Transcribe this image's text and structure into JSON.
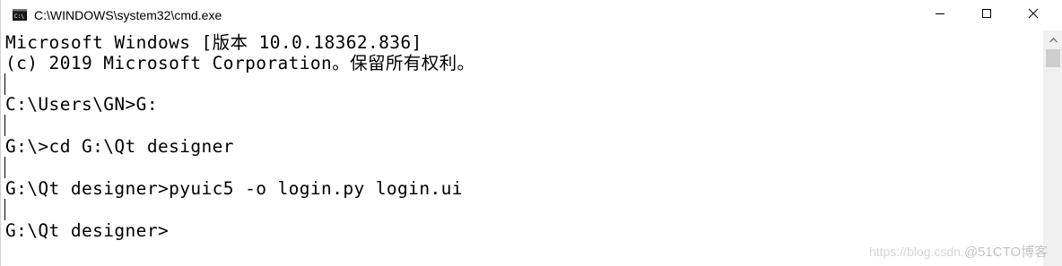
{
  "window": {
    "title": "C:\\WINDOWS\\system32\\cmd.exe",
    "icon": "cmd-console-icon",
    "controls": {
      "minimize_icon": "minimize-icon",
      "maximize_icon": "maximize-icon",
      "close_icon": "close-icon"
    }
  },
  "console": {
    "lines": [
      "Microsoft Windows [版本 10.0.18362.836]",
      "(c) 2019 Microsoft Corporation。保留所有权利。",
      "",
      "C:\\Users\\GN>G:",
      "",
      "G:\\>cd G:\\Qt designer",
      "",
      "G:\\Qt designer>pyuic5 -o login.py login.ui",
      "",
      "G:\\Qt designer>"
    ]
  },
  "scrollbar": {
    "up_icon": "scroll-up-arrow-icon"
  },
  "watermark": {
    "url_text": "https://blog.csdn.",
    "brand_text": "@51CTO博客"
  },
  "colors": {
    "background": "#ffffff",
    "text": "#000000",
    "scrollbar_track": "#f0f0f0",
    "scrollbar_thumb": "#cdcdcd"
  }
}
